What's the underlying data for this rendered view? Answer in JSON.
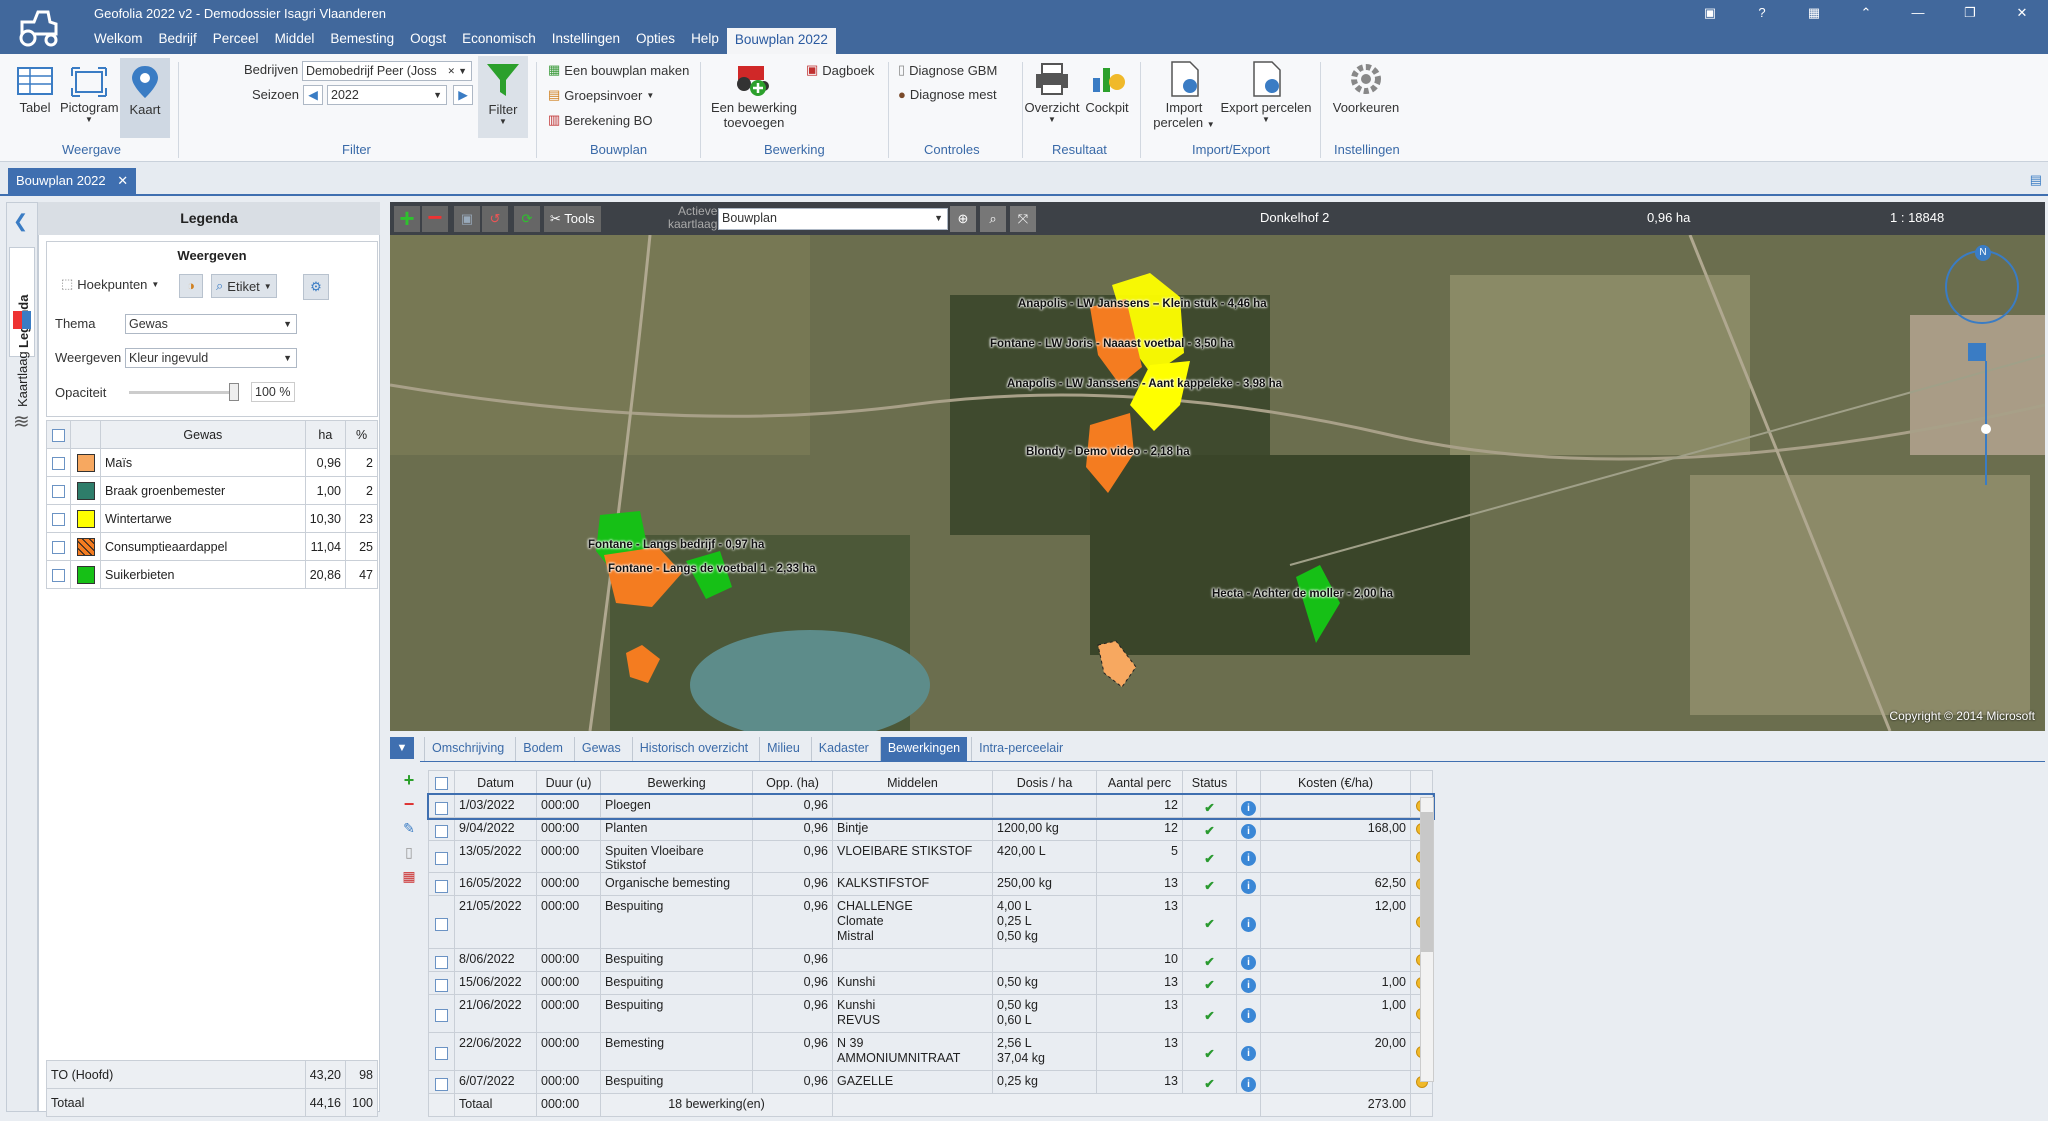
{
  "app": {
    "title": "Geofolia 2022 v2 - Demodossier Isagri Vlaanderen"
  },
  "menu": [
    "Welkom",
    "Bedrijf",
    "Perceel",
    "Middel",
    "Bemesting",
    "Oogst",
    "Economisch",
    "Instellingen",
    "Opties",
    "Help",
    "Bouwplan 2022"
  ],
  "ribbon": {
    "tabel": "Tabel",
    "pictogram": "Pictogram",
    "kaart": "Kaart",
    "weergave": "Weergave",
    "bedrijven_label": "Bedrijven",
    "bedrijven_value": "Demobedrijf Peer (Joss",
    "seizoen_label": "Seizoen",
    "seizoen_value": "2022",
    "filter": "Filter",
    "filter_group": "Filter",
    "bouwplan_maken": "Een bouwplan maken",
    "groepsinvoer": "Groepsinvoer",
    "berekening_bo": "Berekening BO",
    "bouwplan_group": "Bouwplan",
    "bewerking_toevoegen_1": "Een bewerking",
    "bewerking_toevoegen_2": "toevoegen",
    "dagboek": "Dagboek",
    "bewerking_group": "Bewerking",
    "diagnose_gbm": "Diagnose GBM",
    "diagnose_mest": "Diagnose mest",
    "controles_group": "Controles",
    "overzicht": "Overzicht",
    "cockpit": "Cockpit",
    "resultaat_group": "Resultaat",
    "import_1": "Import",
    "import_2": "percelen",
    "export": "Export percelen",
    "importexport_group": "Import/Export",
    "voorkeuren": "Voorkeuren",
    "instellingen_group": "Instellingen"
  },
  "doc_tab": "Bouwplan 2022",
  "side_tabs": {
    "legenda": "Legenda",
    "kaartlaag": "Kaartlaag"
  },
  "legend": {
    "title": "Legenda",
    "weergeven": "Weergeven",
    "hoekpunten": "Hoekpunten",
    "etiket": "Etiket",
    "thema_label": "Thema",
    "thema_value": "Gewas",
    "weergeven_label": "Weergeven",
    "weergeven_value": "Kleur ingevuld",
    "opaciteit_label": "Opaciteit",
    "opaciteit_value": "100 %",
    "columns": [
      "Gewas",
      "ha",
      "%"
    ],
    "rows": [
      {
        "name": "Maïs",
        "ha": "0,96",
        "pct": "2",
        "color": "#f7a860"
      },
      {
        "name": "Braak groenbemester",
        "ha": "1,00",
        "pct": "2",
        "color": "#2e7d6a"
      },
      {
        "name": "Wintertarwe",
        "ha": "10,30",
        "pct": "23",
        "color": "#ffff00"
      },
      {
        "name": "Consumptieaardappel",
        "ha": "11,04",
        "pct": "25",
        "color": "#f47c20"
      },
      {
        "name": "Suikerbieten",
        "ha": "20,86",
        "pct": "47",
        "color": "#16c016"
      }
    ],
    "totals": [
      {
        "label": "TO (Hoofd)",
        "ha": "43,20",
        "pct": "98"
      },
      {
        "label": "Totaal",
        "ha": "44,16",
        "pct": "100"
      }
    ]
  },
  "maptool": {
    "tools": "Tools",
    "actieve_1": "Actieve",
    "actieve_2": "kaartlaag",
    "layer": "Bouwplan",
    "perceel": "Donkelhof 2",
    "area": "0,96 ha",
    "scale": "1 : 18848",
    "copyright": "Copyright © 2014 Microsoft",
    "north": "N"
  },
  "map_labels": [
    "Anapolis - LW Janssens – Klein stuk - 4,46 ha",
    "Fontane - LW Joris - Naaast voetbal - 3,50 ha",
    "Anapolis - LW Janssens - Aant kappeleke - 3,98 ha",
    "Blondy - Demo video - 2,18 ha",
    "Fontane - Langs bedrijf - 0,97 ha",
    "Fontane - Langs de voetbal 1 - 2,33 ha",
    "Hecta - Achter de moller - 2,00 ha"
  ],
  "bottom_tabs": [
    "Omschrijving",
    "Bodem",
    "Gewas",
    "Historisch overzicht",
    "Milieu",
    "Kadaster",
    "Bewerkingen",
    "Intra-perceelair"
  ],
  "ops": {
    "columns": [
      "Datum",
      "Duur (u)",
      "Bewerking",
      "Opp. (ha)",
      "Middelen",
      "Dosis / ha",
      "Aantal perc",
      "Status",
      "Kosten (€/ha)"
    ],
    "rows": [
      {
        "datum": "1/03/2022",
        "duur": "000:00",
        "bew": "Ploegen",
        "opp": "0,96",
        "mid": [],
        "dos": [],
        "aantal": "12",
        "kost": ""
      },
      {
        "datum": "9/04/2022",
        "duur": "000:00",
        "bew": "Planten",
        "opp": "0,96",
        "mid": [
          "Bintje"
        ],
        "dos": [
          "1200,00 kg"
        ],
        "aantal": "12",
        "kost": "168,00"
      },
      {
        "datum": "13/05/2022",
        "duur": "000:00",
        "bew": "Spuiten Vloeibare Stikstof",
        "opp": "0,96",
        "mid": [
          "VLOEIBARE STIKSTOF"
        ],
        "dos": [
          "420,00 L"
        ],
        "aantal": "5",
        "kost": ""
      },
      {
        "datum": "16/05/2022",
        "duur": "000:00",
        "bew": "Organische bemesting",
        "opp": "0,96",
        "mid": [
          "KALKSTIFSTOF"
        ],
        "dos": [
          "250,00 kg"
        ],
        "aantal": "13",
        "kost": "62,50"
      },
      {
        "datum": "21/05/2022",
        "duur": "000:00",
        "bew": "Bespuiting",
        "opp": "0,96",
        "mid": [
          "CHALLENGE",
          "Clomate",
          "Mistral"
        ],
        "dos": [
          "4,00 L",
          "0,25 L",
          "0,50 kg"
        ],
        "aantal": "13",
        "kost": "12,00"
      },
      {
        "datum": "8/06/2022",
        "duur": "000:00",
        "bew": "Bespuiting",
        "opp": "0,96",
        "mid": [],
        "dos": [],
        "aantal": "10",
        "kost": ""
      },
      {
        "datum": "15/06/2022",
        "duur": "000:00",
        "bew": "Bespuiting",
        "opp": "0,96",
        "mid": [
          "Kunshi"
        ],
        "dos": [
          "0,50 kg"
        ],
        "aantal": "13",
        "kost": "1,00"
      },
      {
        "datum": "21/06/2022",
        "duur": "000:00",
        "bew": "Bespuiting",
        "opp": "0,96",
        "mid": [
          "Kunshi",
          "REVUS"
        ],
        "dos": [
          "0,50 kg",
          "0,60 L"
        ],
        "aantal": "13",
        "kost": "1,00"
      },
      {
        "datum": "22/06/2022",
        "duur": "000:00",
        "bew": "Bemesting",
        "opp": "0,96",
        "mid": [
          "N 39",
          "AMMONIUMNITRAAT"
        ],
        "dos": [
          "2,56 L",
          "37,04 kg"
        ],
        "aantal": "13",
        "kost": "20,00"
      },
      {
        "datum": "6/07/2022",
        "duur": "000:00",
        "bew": "Bespuiting",
        "opp": "0,96",
        "mid": [
          "GAZELLE"
        ],
        "dos": [
          "0,25 kg"
        ],
        "aantal": "13",
        "kost": ""
      }
    ],
    "total": {
      "label": "Totaal",
      "duur": "000:00",
      "count": "18 bewerking(en)",
      "kost": "273.00"
    }
  }
}
